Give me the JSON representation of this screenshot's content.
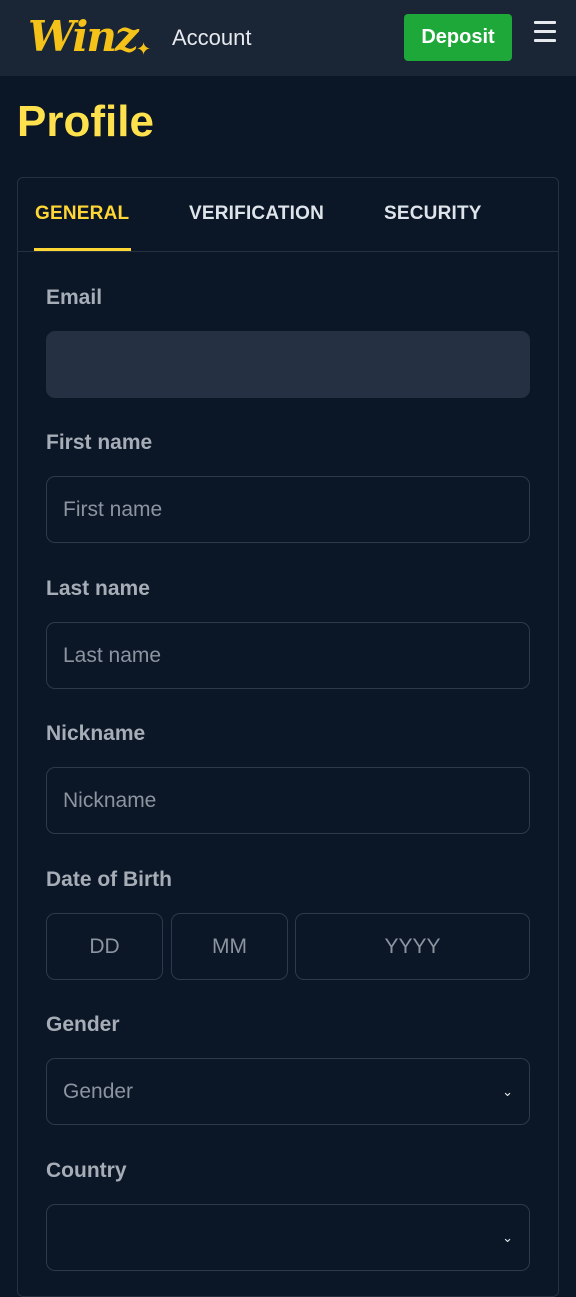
{
  "header": {
    "logo_text": "Winz",
    "logo_star": "✦",
    "section_label": "Account",
    "deposit_label": "Deposit"
  },
  "page": {
    "title": "Profile"
  },
  "tabs": [
    {
      "label": "GENERAL",
      "active": true
    },
    {
      "label": "VERIFICATION",
      "active": false
    },
    {
      "label": "SECURITY",
      "active": false
    }
  ],
  "form": {
    "email": {
      "label": "Email",
      "value": ""
    },
    "first_name": {
      "label": "First name",
      "placeholder": "First name"
    },
    "last_name": {
      "label": "Last name",
      "placeholder": "Last name"
    },
    "nickname": {
      "label": "Nickname",
      "placeholder": "Nickname"
    },
    "dob": {
      "label": "Date of Birth",
      "day": "DD",
      "month": "MM",
      "year": "YYYY"
    },
    "gender": {
      "label": "Gender",
      "selected": "Gender"
    },
    "country": {
      "label": "Country",
      "selected": ""
    }
  },
  "colors": {
    "accent": "#ffd633",
    "deposit": "#1ea83a",
    "background": "#0b1626",
    "header": "#1a2535"
  },
  "icons": {
    "menu": "hamburger-icon",
    "select": "chevron-down-icon"
  }
}
